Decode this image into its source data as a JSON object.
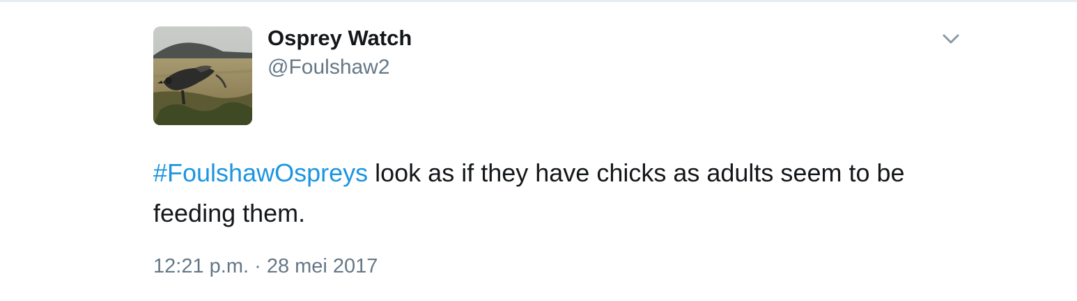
{
  "author": {
    "display_name": "Osprey Watch",
    "handle": "@Foulshaw2",
    "avatar_icon": "osprey-avatar-photo"
  },
  "menu": {
    "icon": "chevron-down-icon"
  },
  "tweet": {
    "hashtag": "#FoulshawOspreys",
    "text": " look as if they have chicks as adults seem to be feeding them.",
    "time": "12:21 p.m.",
    "separator": " · ",
    "date": "28 mei 2017"
  },
  "colors": {
    "link": "#1b95e0",
    "secondary_text": "#657786",
    "primary_text": "#14171a"
  }
}
